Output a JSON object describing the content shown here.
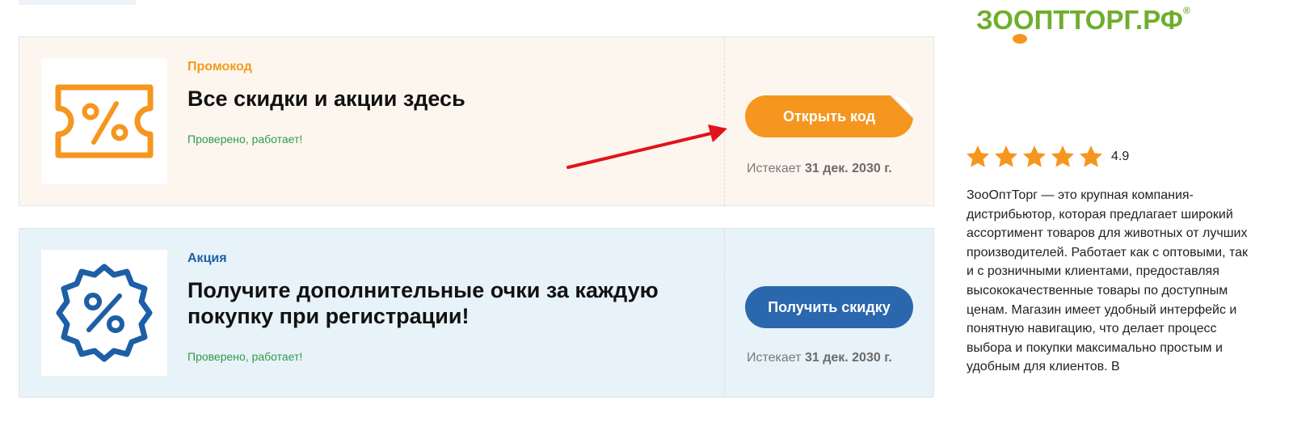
{
  "cards": [
    {
      "type_label": "Промокод",
      "title": "Все скидки и акции здесь",
      "verified": "Проверено, работает!",
      "button_label": "Открыть код",
      "expires_prefix": "Истекает",
      "expires_date": "31 дек. 2030 г.",
      "icon": "ticket-percent-icon",
      "accent": "#f5961e"
    },
    {
      "type_label": "Акция",
      "title": "Получите дополнительные очки за каждую покупку при регистрации!",
      "verified": "Проверено, работает!",
      "button_label": "Получить скидку",
      "expires_prefix": "Истекает",
      "expires_date": "31 дек. 2030 г.",
      "icon": "badge-percent-icon",
      "accent": "#2a67ad"
    }
  ],
  "sidebar": {
    "logo_text": "ЗООПТТОРГ.РФ",
    "logo_mark": "®",
    "rating": {
      "value": "4.9",
      "stars": 5,
      "star_color": "#f5961e"
    },
    "description": "ЗооОптТорг — это крупная компания-дистрибьютор, которая предлагает широкий ассортимент товаров для животных от лучших производителей. Работает как с оптовыми, так и с розничными клиентами, предоставляя высококачественные товары по доступным ценам. Магазин имеет удобный интерфейс и понятную навигацию, что делает процесс выбора и покупки максимально простым и удобным для клиентов. В"
  },
  "colors": {
    "promo_bg": "#fdf6ee",
    "deal_bg": "#e8f2f9",
    "verified": "#2f9a4a",
    "annotation_arrow": "#e0141b"
  }
}
